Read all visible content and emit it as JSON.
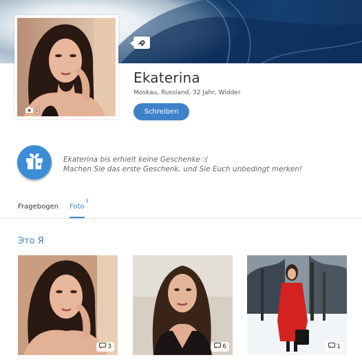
{
  "profile": {
    "name": "Ekaterina",
    "meta": "Moskau, Russland, 32 Jahr, Widder",
    "photo_count": "3",
    "write_button": "Schreiben"
  },
  "gifts": {
    "line1": "Ekaterina bis erhielt keine Geschenke :(",
    "line2": "Machen Sie das erste Geschenk, und Sie Euch unbedingt merken!"
  },
  "tabs": {
    "questionnaire": "Fragebogen",
    "photo": "Foto",
    "photo_badge": "3"
  },
  "album": {
    "title": "Это Я",
    "photos": [
      {
        "comments": "3"
      },
      {
        "comments": "6"
      },
      {
        "comments": "1"
      }
    ]
  },
  "colors": {
    "accent": "#3b86c8",
    "button": "#3f82c9"
  }
}
